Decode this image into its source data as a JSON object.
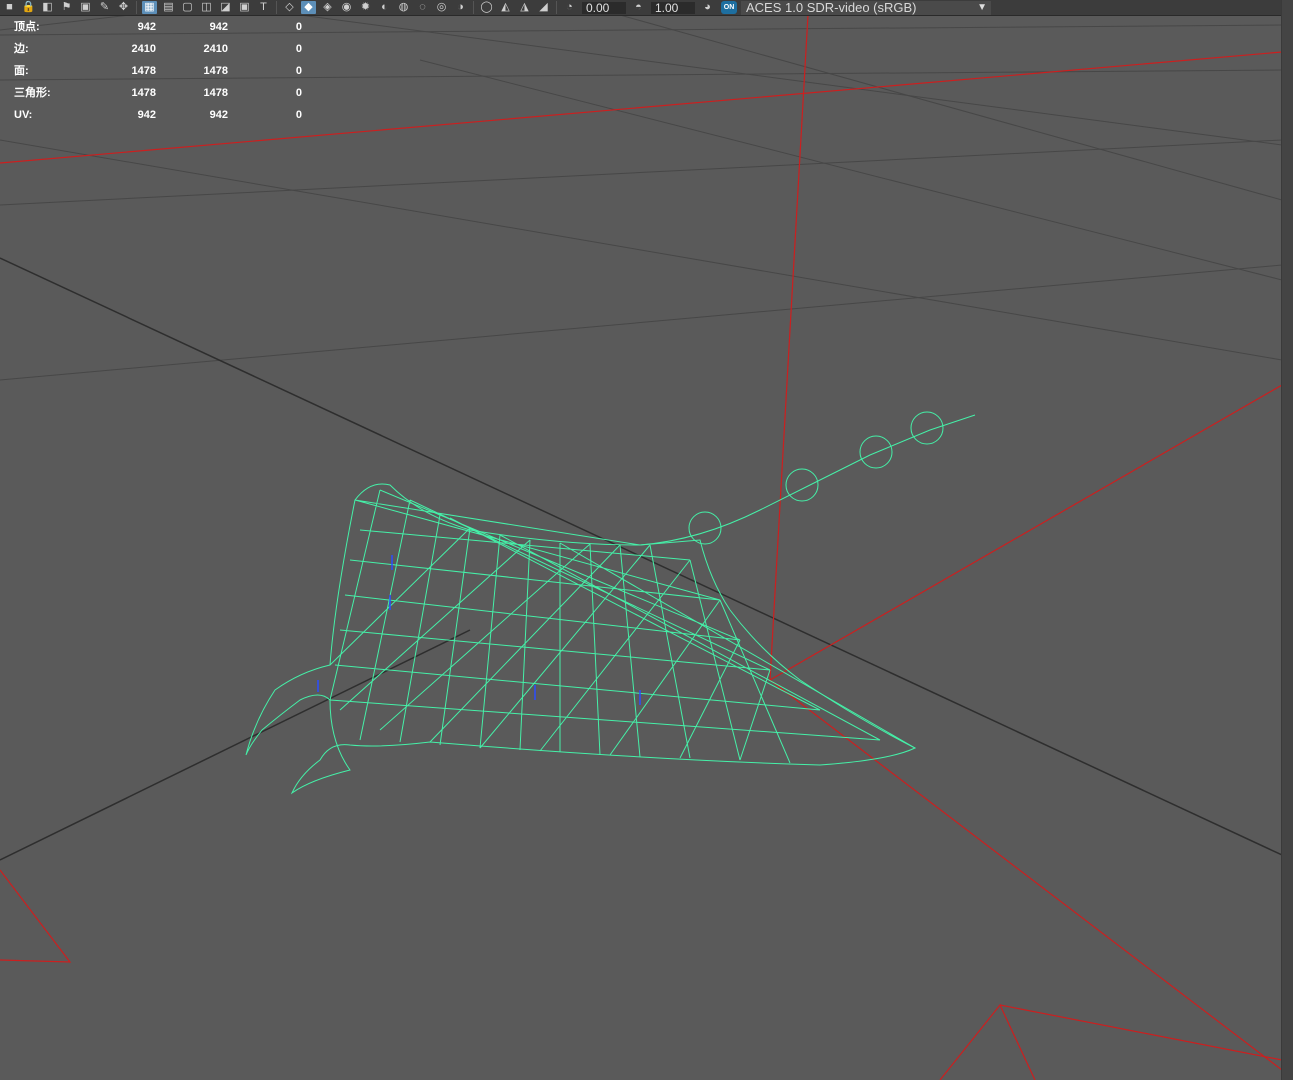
{
  "toolbar": {
    "icons": [
      "camera-icon",
      "lock-camera-icon",
      "camera-attributes-icon",
      "bookmark-icon",
      "image-plane-icon",
      "grease-pencil-icon",
      "2d-pan-icon",
      "grid-icon",
      "film-gate-icon",
      "resolution-gate-icon",
      "gate-mask-icon",
      "field-chart-icon",
      "safe-action-icon",
      "safe-title-icon",
      "wireframe-icon",
      "smooth-shade-icon",
      "wireframe-on-shaded-icon",
      "textured-icon",
      "use-all-lights-icon",
      "shadows-icon",
      "screen-space-ao-icon",
      "motion-blur-icon",
      "multisample-aa-icon",
      "depth-of-field-icon",
      "isolate-select-icon",
      "xray-icon",
      "xray-joints-icon",
      "backface-culling-icon",
      "exposure-icon",
      "gamma-icon",
      "color-management-icon"
    ],
    "exposure_value": "0.00",
    "gamma_value": "1.00",
    "aces_badge": "ON",
    "color_space": "ACES 1.0 SDR-video (sRGB)"
  },
  "hud": {
    "rows": [
      {
        "label": "顶点:",
        "v1": "942",
        "v2": "942",
        "v3": "0"
      },
      {
        "label": "边:",
        "v1": "2410",
        "v2": "2410",
        "v3": "0"
      },
      {
        "label": "面:",
        "v1": "1478",
        "v2": "1478",
        "v3": "0"
      },
      {
        "label": "三角形:",
        "v1": "1478",
        "v2": "1478",
        "v3": "0"
      },
      {
        "label": "UV:",
        "v1": "942",
        "v2": "942",
        "v3": "0"
      }
    ]
  },
  "colors": {
    "viewport_bg": "#5a5a5a",
    "grid_line": "#474747",
    "axis_line": "#2e2e2e",
    "red_line": "#cc1f1f",
    "wireframe": "#45f0a8"
  }
}
